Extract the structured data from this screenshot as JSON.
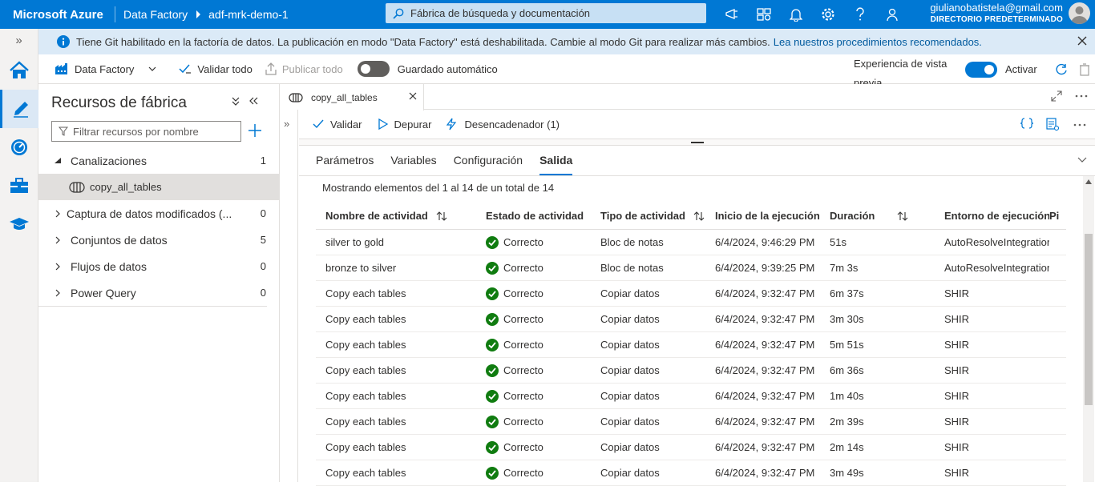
{
  "topbar": {
    "brand": "Microsoft Azure",
    "crumb1": "Data Factory",
    "crumb2": "adf-mrk-demo-1",
    "search_placeholder": "Fábrica de búsqueda y documentación",
    "user_email": "giulianobatistela@gmail.com",
    "user_directory": "DIRECTORIO PREDETERMINADO",
    "icons": [
      "megaphone-icon",
      "portal-settings-icon",
      "bell-icon",
      "gear-icon",
      "help-icon",
      "feedback-icon"
    ]
  },
  "notice": {
    "text": "Tiene Git habilitado en la factoría de datos. La publicación en modo \"Data Factory\" está deshabilitada. Cambie al modo Git para realizar más cambios.",
    "link": "Lea nuestros procedimientos recomendados."
  },
  "toolbar": {
    "mode": "Data Factory",
    "validate_all": "Validar todo",
    "publish_all": "Publicar todo",
    "autosave": "Guardado automático",
    "autosave_on": false,
    "preview_line1": "Experiencia de vista",
    "preview_line2": "previa",
    "activate": "Activar",
    "preview_on": true
  },
  "resources": {
    "title": "Recursos de fábrica",
    "filter_placeholder": "Filtrar recursos por nombre",
    "items": [
      {
        "label": "Canalizaciones",
        "count": "1",
        "expanded": true
      },
      {
        "label": "copy_all_tables",
        "child": true
      },
      {
        "label": "Captura de datos modificados (...",
        "count": "0"
      },
      {
        "label": "Conjuntos de datos",
        "count": "5"
      },
      {
        "label": "Flujos de datos",
        "count": "0"
      },
      {
        "label": "Power Query",
        "count": "0"
      }
    ]
  },
  "editor": {
    "tab_label": "copy_all_tables",
    "actions": {
      "validate": "Validar",
      "debug": "Depurar",
      "trigger": "Desencadenador (1)"
    }
  },
  "panel": {
    "tabs": [
      "Parámetros",
      "Variables",
      "Configuración",
      "Salida"
    ],
    "active_tab": "Salida",
    "showing": "Mostrando elementos del 1 al 14 de un total de 14",
    "columns": [
      "Nombre de actividad",
      "Estado de actividad",
      "Tipo de actividad",
      "Inicio de la ejecución",
      "Duración",
      "Entorno de ejecución de",
      "Pi"
    ],
    "rows": [
      {
        "name": "silver to gold",
        "status": "Correcto",
        "type": "Bloc de notas",
        "start": "6/4/2024, 9:46:29 PM",
        "duration": "51s",
        "runtime": "AutoResolveIntegrationRuntime"
      },
      {
        "name": "bronze to silver",
        "status": "Correcto",
        "type": "Bloc de notas",
        "start": "6/4/2024, 9:39:25 PM",
        "duration": "7m 3s",
        "runtime": "AutoResolveIntegrationRuntime"
      },
      {
        "name": "Copy each tables",
        "status": "Correcto",
        "type": "Copiar datos",
        "start": "6/4/2024, 9:32:47 PM",
        "duration": "6m 37s",
        "runtime": "SHIR"
      },
      {
        "name": "Copy each tables",
        "status": "Correcto",
        "type": "Copiar datos",
        "start": "6/4/2024, 9:32:47 PM",
        "duration": "3m 30s",
        "runtime": "SHIR"
      },
      {
        "name": "Copy each tables",
        "status": "Correcto",
        "type": "Copiar datos",
        "start": "6/4/2024, 9:32:47 PM",
        "duration": "5m 51s",
        "runtime": "SHIR"
      },
      {
        "name": "Copy each tables",
        "status": "Correcto",
        "type": "Copiar datos",
        "start": "6/4/2024, 9:32:47 PM",
        "duration": "6m 36s",
        "runtime": "SHIR"
      },
      {
        "name": "Copy each tables",
        "status": "Correcto",
        "type": "Copiar datos",
        "start": "6/4/2024, 9:32:47 PM",
        "duration": "1m 40s",
        "runtime": "SHIR"
      },
      {
        "name": "Copy each tables",
        "status": "Correcto",
        "type": "Copiar datos",
        "start": "6/4/2024, 9:32:47 PM",
        "duration": "2m 39s",
        "runtime": "SHIR"
      },
      {
        "name": "Copy each tables",
        "status": "Correcto",
        "type": "Copiar datos",
        "start": "6/4/2024, 9:32:47 PM",
        "duration": "2m 14s",
        "runtime": "SHIR"
      },
      {
        "name": "Copy each tables",
        "status": "Correcto",
        "type": "Copiar datos",
        "start": "6/4/2024, 9:32:47 PM",
        "duration": "3m 49s",
        "runtime": "SHIR"
      }
    ]
  },
  "colors": {
    "accent": "#0078d4",
    "success": "#107c10",
    "notice_bg": "#dbeaf7"
  }
}
